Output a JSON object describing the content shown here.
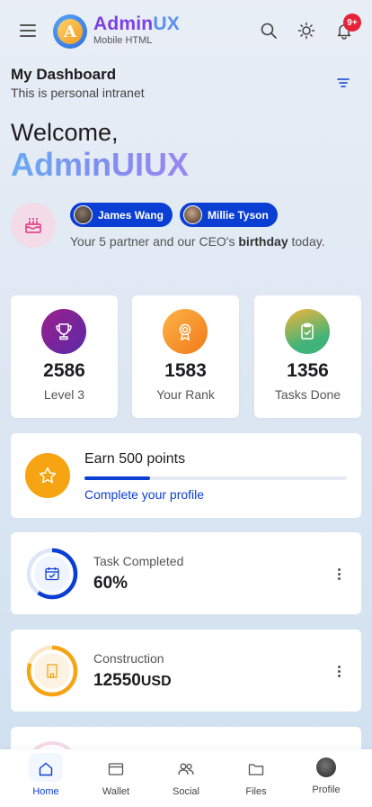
{
  "header": {
    "brand_name": "AdminUX",
    "brand_name_main": "Admin",
    "brand_name_accent": "UX",
    "brand_subtitle": "Mobile HTML",
    "logo_letter": "A",
    "notification_count": "9+"
  },
  "dashboard": {
    "title": "My Dashboard",
    "subtitle": "This is personal intranet"
  },
  "welcome": {
    "greeting": "Welcome,",
    "username": "AdminUIUX"
  },
  "birthday": {
    "people": [
      {
        "name": "James Wang"
      },
      {
        "name": "Millie Tyson"
      }
    ],
    "text_before": "Your 5 partner and our CEO's ",
    "text_bold": "birthday",
    "text_after": " today."
  },
  "stats": [
    {
      "value": "2586",
      "label": "Level 3",
      "icon": "trophy-icon",
      "color_from": "#9b1f8c",
      "color_to": "#5a2aa8"
    },
    {
      "value": "1583",
      "label": "Your Rank",
      "icon": "medal-icon",
      "color_from": "#ffb347",
      "color_to": "#f07a1a"
    },
    {
      "value": "1356",
      "label": "Tasks Done",
      "icon": "clipboard-check-icon",
      "color_from": "#f2b53a",
      "color_to": "#3fb37a"
    }
  ],
  "earn": {
    "title": "Earn 500 points",
    "link": "Complete your profile",
    "progress": 0.25,
    "icon": "star-icon"
  },
  "metrics": [
    {
      "label": "Task Completed",
      "value": "60%",
      "unit": "",
      "progress": 0.6,
      "color": "#0b3fd4",
      "icon": "calendar-check-icon"
    },
    {
      "label": "Construction",
      "value": "12550",
      "unit": "USD",
      "progress": 0.8,
      "color": "#f6a412",
      "icon": "building-icon"
    }
  ],
  "nav": [
    {
      "label": "Home",
      "icon": "home-icon",
      "active": true
    },
    {
      "label": "Wallet",
      "icon": "wallet-icon",
      "active": false
    },
    {
      "label": "Social",
      "icon": "people-icon",
      "active": false
    },
    {
      "label": "Files",
      "icon": "folder-icon",
      "active": false
    },
    {
      "label": "Profile",
      "icon": "avatar",
      "active": false
    }
  ],
  "colors": {
    "accent": "#0b3fd4",
    "brand_purple": "#7b3fe4",
    "badge_red": "#e5243a"
  }
}
